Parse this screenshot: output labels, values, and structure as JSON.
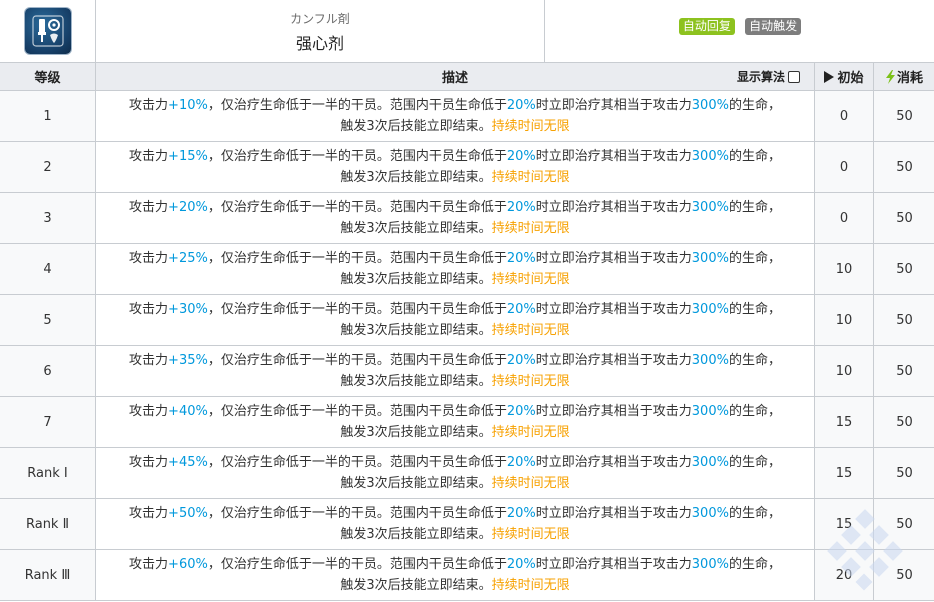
{
  "skill": {
    "icon": "medical-syringe-icon",
    "name_jp": "カンフル剤",
    "name_cn": "强心剂",
    "tags": [
      {
        "label": "自动回复",
        "color": "#8dc21f"
      },
      {
        "label": "自动触发",
        "color": "#7d7d7d"
      }
    ]
  },
  "columns": {
    "level": "等级",
    "description": "描述",
    "show_formula": "显示算法",
    "initial_sp": "初始",
    "sp_cost": "消耗"
  },
  "desc_parts": {
    "p1": "攻击力",
    "p2": "，仅治疗生命低于一半的干员。范围内干员生命低于",
    "p3": "20%",
    "p4": "时立即治疗其相当于攻击力",
    "p5": "300%",
    "p6": "的生命，",
    "p7": "触发3次后技能立即结束。",
    "p8": "持续时间无限"
  },
  "rows": [
    {
      "level": "1",
      "atk": "+10%",
      "initial": "0",
      "cost": "50"
    },
    {
      "level": "2",
      "atk": "+15%",
      "initial": "0",
      "cost": "50"
    },
    {
      "level": "3",
      "atk": "+20%",
      "initial": "0",
      "cost": "50"
    },
    {
      "level": "4",
      "atk": "+25%",
      "initial": "10",
      "cost": "50"
    },
    {
      "level": "5",
      "atk": "+30%",
      "initial": "10",
      "cost": "50"
    },
    {
      "level": "6",
      "atk": "+35%",
      "initial": "10",
      "cost": "50"
    },
    {
      "level": "7",
      "atk": "+40%",
      "initial": "15",
      "cost": "50"
    },
    {
      "level": "Rank Ⅰ",
      "atk": "+45%",
      "initial": "15",
      "cost": "50"
    },
    {
      "level": "Rank Ⅱ",
      "atk": "+50%",
      "initial": "15",
      "cost": "50"
    },
    {
      "level": "Rank Ⅲ",
      "atk": "+60%",
      "initial": "20",
      "cost": "50"
    }
  ],
  "colors": {
    "highlight_blue": "#0098dc",
    "highlight_orange": "#f7a100",
    "header_bg": "#eaecf0",
    "cell_bg": "#f8f9fa"
  }
}
